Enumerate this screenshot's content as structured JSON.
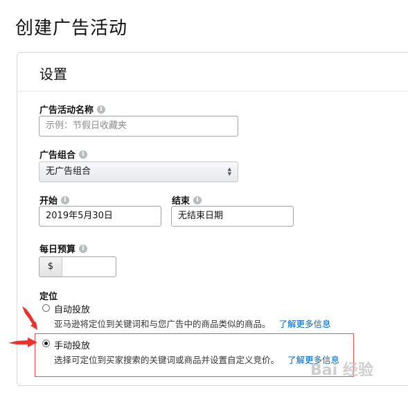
{
  "page": {
    "title": "创建广告活动"
  },
  "settings": {
    "title": "设置",
    "campaign_name": {
      "label": "广告活动名称",
      "value": "",
      "placeholder": "示例：节假日收藏夹"
    },
    "portfolio": {
      "label": "广告组合",
      "selected": "无广告组合"
    },
    "start": {
      "label": "开始",
      "value": "2019年5月30日"
    },
    "end": {
      "label": "结束",
      "value": "无结束日期"
    },
    "daily_budget": {
      "label": "每日预算",
      "currency": "$",
      "value": ""
    },
    "targeting": {
      "label": "定位",
      "options": [
        {
          "title": "自动投放",
          "description": "亚马逊将定位到关键词和与您广告中的商品类似的商品。",
          "link": "了解更多信息",
          "selected": false
        },
        {
          "title": "手动投放",
          "description": "选择可定位到买家搜索的关键词或商品并设置自定义竞价。",
          "link": "了解更多信息",
          "selected": true
        }
      ]
    }
  },
  "annotation": {
    "highlight_color": "#e5554a",
    "watermark": "Bai 经验"
  },
  "colors": {
    "link": "#0066c0",
    "border": "#d5d9d9"
  },
  "icons": {
    "info": "info-circle-icon",
    "select": "sort-arrows-icon",
    "annotation": "red-arrow-icon"
  }
}
